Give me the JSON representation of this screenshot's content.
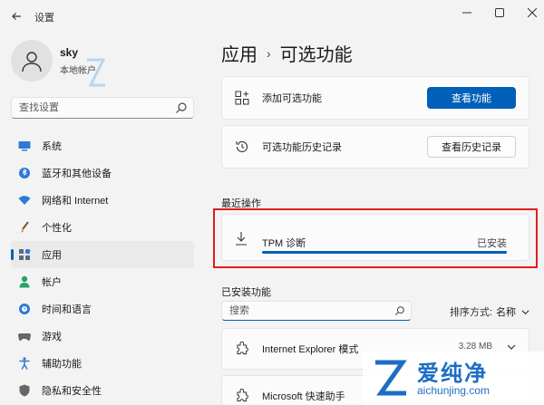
{
  "window": {
    "title": "设置",
    "back_icon": "back-arrow-icon",
    "min_icon": "minimize-icon",
    "max_icon": "maximize-icon",
    "close_icon": "close-icon"
  },
  "profile": {
    "name": "sky",
    "account_type": "本地帐户"
  },
  "search": {
    "placeholder": "查找设置"
  },
  "sidebar": {
    "items": [
      {
        "label": "系统",
        "icon": "system-icon",
        "color": "#2b7bd4"
      },
      {
        "label": "蓝牙和其他设备",
        "icon": "bluetooth-icon",
        "color": "#2b7bd4"
      },
      {
        "label": "网络和 Internet",
        "icon": "wifi-icon",
        "color": "#2b7bd4"
      },
      {
        "label": "个性化",
        "icon": "brush-icon",
        "color": "#c47a2a"
      },
      {
        "label": "应用",
        "icon": "apps-icon",
        "color": "#5a6b80",
        "active": true
      },
      {
        "label": "帐户",
        "icon": "person-icon",
        "color": "#2aa36b"
      },
      {
        "label": "时间和语言",
        "icon": "globe-clock-icon",
        "color": "#2b7bd4"
      },
      {
        "label": "游戏",
        "icon": "gamepad-icon",
        "color": "#666666"
      },
      {
        "label": "辅助功能",
        "icon": "accessibility-icon",
        "color": "#2b7bd4"
      },
      {
        "label": "隐私和安全性",
        "icon": "shield-icon",
        "color": "#666666"
      }
    ]
  },
  "main": {
    "breadcrumb": {
      "parent": "应用",
      "separator": "›",
      "current": "可选功能"
    },
    "add_card": {
      "label": "添加可选功能",
      "button": "查看功能",
      "icon": "add-grid-icon"
    },
    "history_card": {
      "label": "可选功能历史记录",
      "button": "查看历史记录",
      "icon": "history-icon"
    },
    "recent": {
      "title": "最近操作",
      "item": {
        "label": "TPM 诊断",
        "status": "已安装",
        "icon": "download-icon",
        "progress": 1.0
      }
    },
    "installed": {
      "title": "已安装功能",
      "search_placeholder": "搜索",
      "sort_label": "排序方式:",
      "sort_value": "名称",
      "features": [
        {
          "label": "Internet Explorer 模式",
          "size": "3.28 MB",
          "icon": "puzzle-icon"
        },
        {
          "label": "Microsoft 快速助手",
          "size": "",
          "icon": "puzzle-icon"
        }
      ]
    }
  },
  "watermark": {
    "brand": "爱纯净",
    "url": "aichunjing.com"
  },
  "colors": {
    "accent": "#005fb8",
    "highlight": "#e11d1d"
  }
}
